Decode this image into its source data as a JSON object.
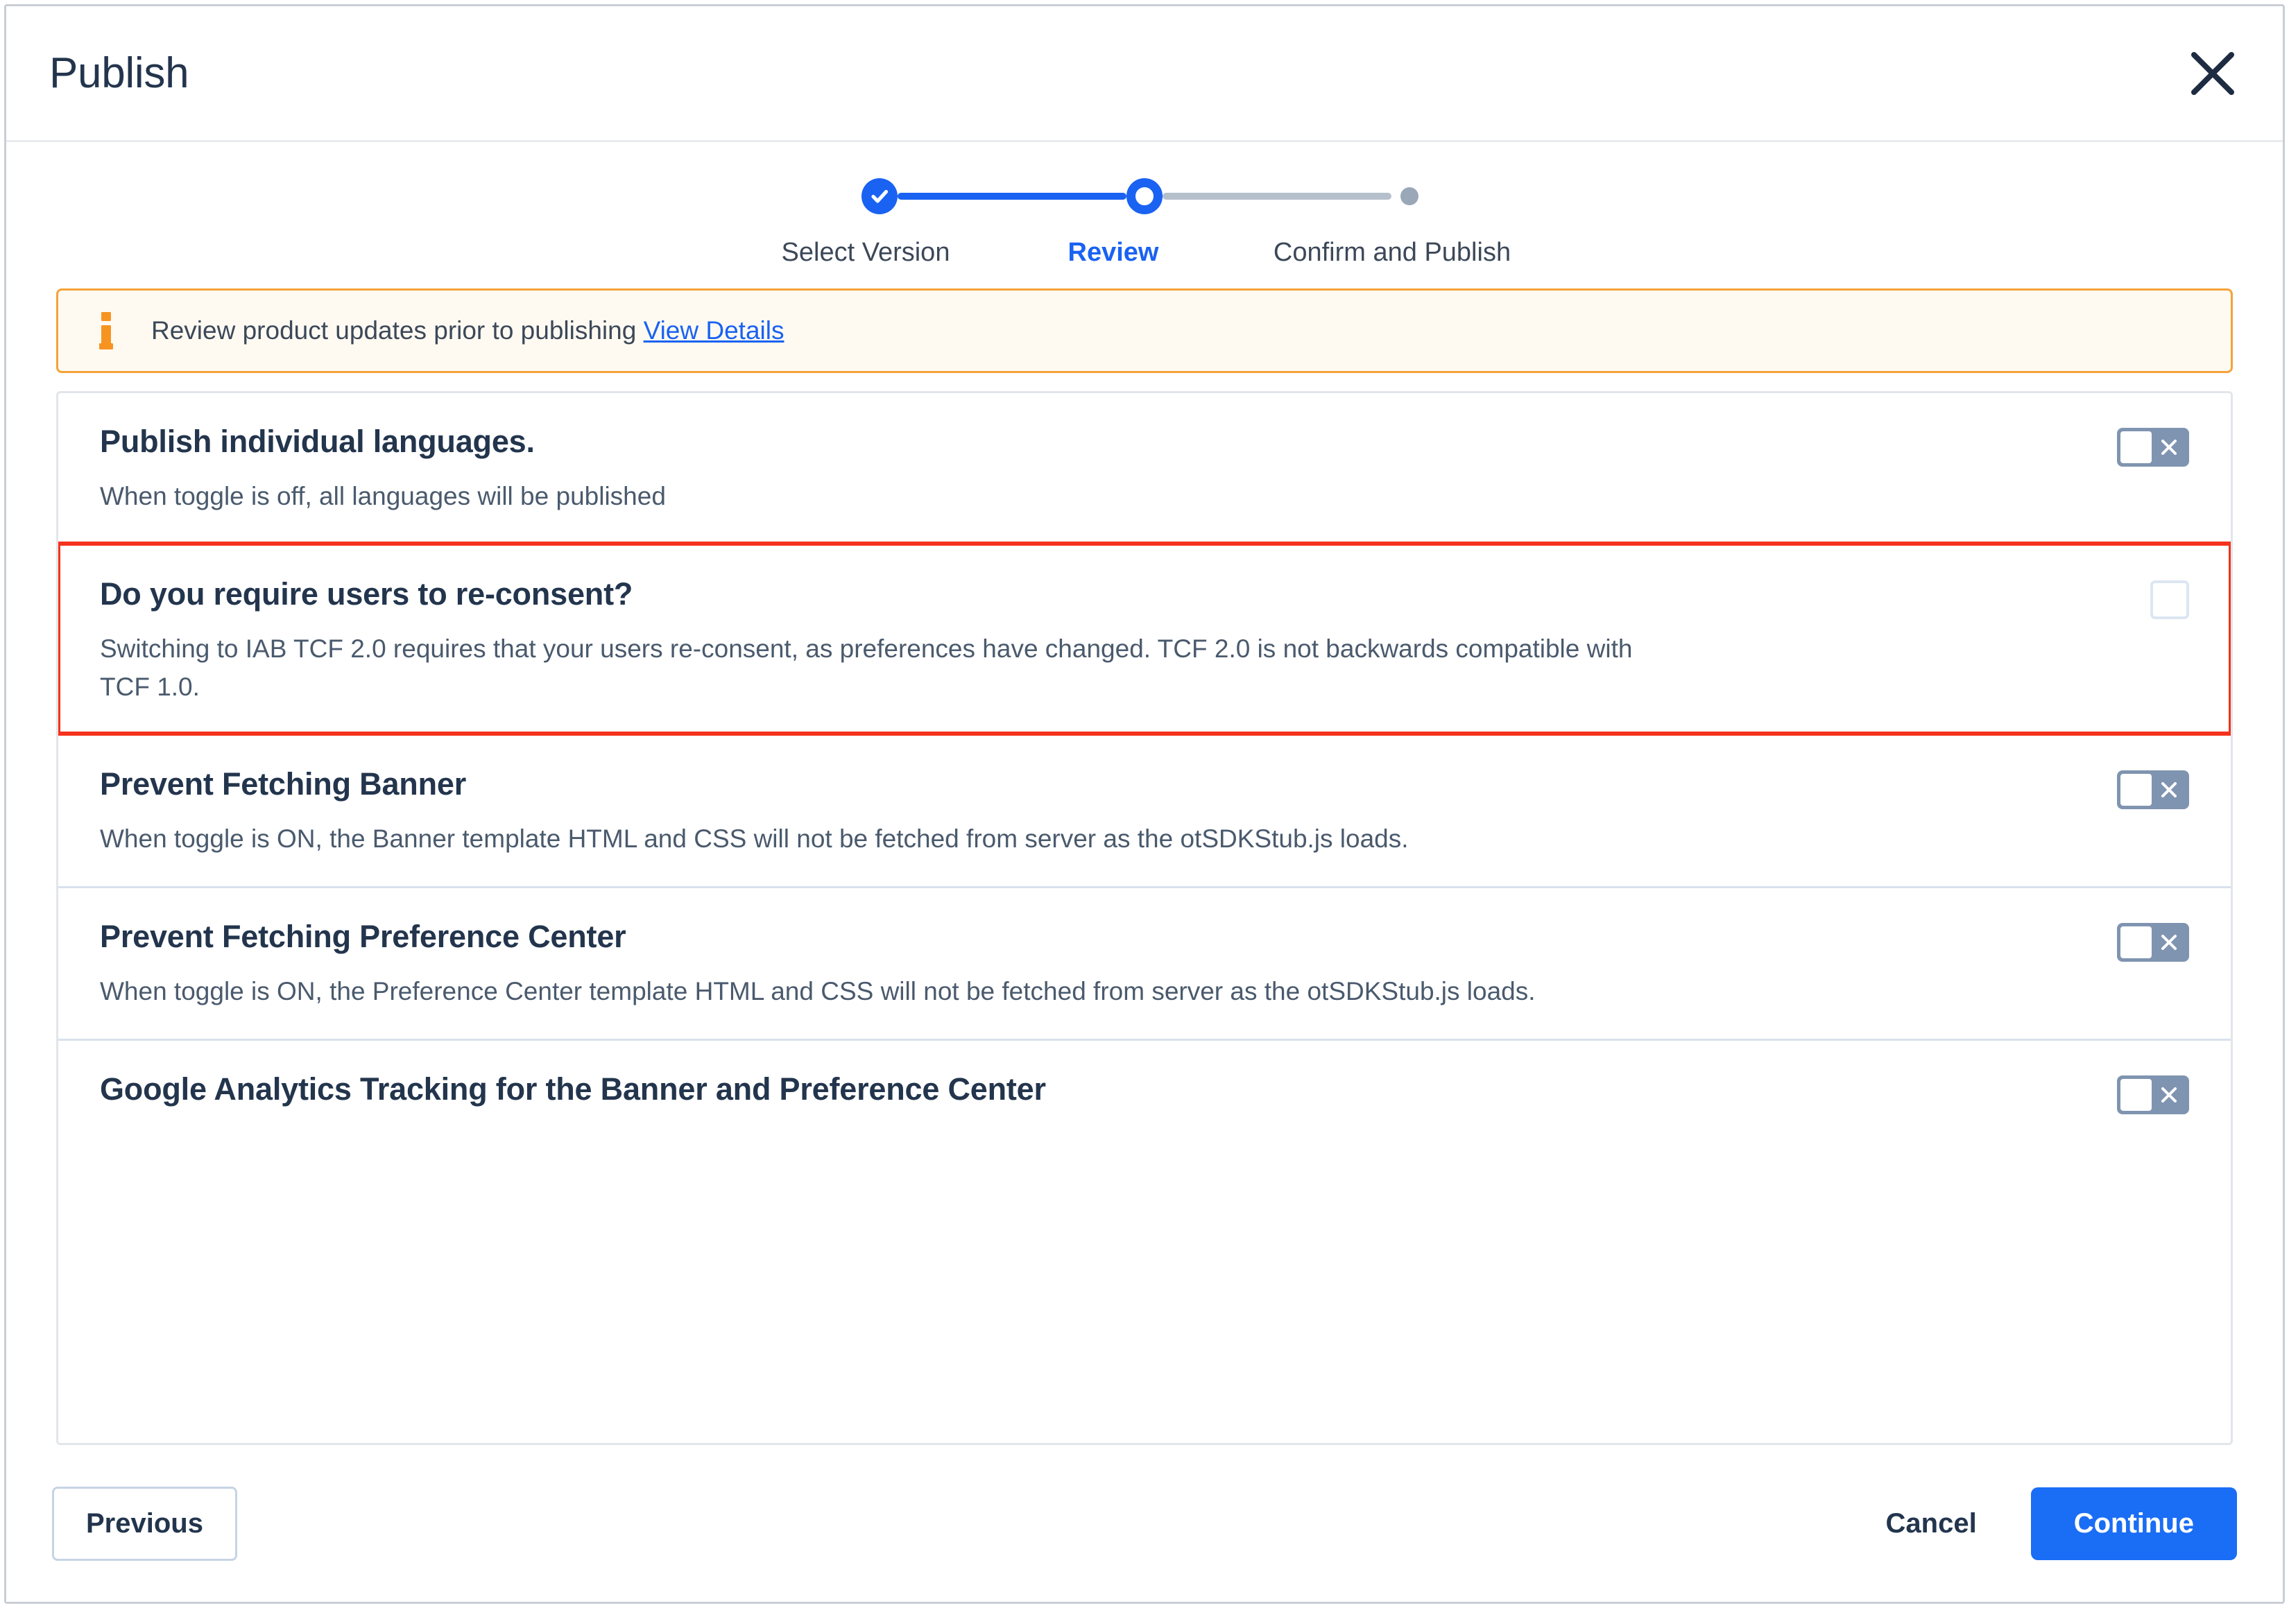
{
  "modal": {
    "title": "Publish",
    "close_icon": "close-icon"
  },
  "stepper": {
    "steps": [
      {
        "label": "Select Version",
        "state": "completed"
      },
      {
        "label": "Review",
        "state": "current"
      },
      {
        "label": "Confirm and Publish",
        "state": "upcoming"
      }
    ],
    "active_color": "#1a62f2",
    "inactive_color": "#b6c0cd"
  },
  "info_banner": {
    "icon": "info-icon",
    "message": "Review product updates prior to publishing",
    "link_label": "View Details",
    "border_color": "#f5a33a",
    "background_color": "#fefaf2"
  },
  "settings": [
    {
      "title": "Publish individual languages.",
      "description": "When toggle is off, all languages will be published",
      "control": "toggle",
      "control_state": "off",
      "highlighted": false
    },
    {
      "title": "Do you require users to re-consent?",
      "description": "Switching to IAB TCF 2.0 requires that your users re-consent, as preferences have changed. TCF 2.0 is not backwards compatible with TCF 1.0.",
      "control": "checkbox",
      "control_state": "unchecked",
      "highlighted": true,
      "highlight_color": "#f5321d"
    },
    {
      "title": "Prevent Fetching Banner",
      "description": "When toggle is ON, the Banner template HTML and CSS will not be fetched from server as the otSDKStub.js loads.",
      "control": "toggle",
      "control_state": "off",
      "highlighted": false
    },
    {
      "title": "Prevent Fetching Preference Center",
      "description": "When toggle is ON, the Preference Center template HTML and CSS will not be fetched from server as the otSDKStub.js loads.",
      "control": "toggle",
      "control_state": "off",
      "highlighted": false
    },
    {
      "title": "Google Analytics Tracking for the Banner and Preference Center",
      "description": "",
      "control": "toggle",
      "control_state": "off",
      "highlighted": false
    }
  ],
  "footer": {
    "previous_label": "Previous",
    "cancel_label": "Cancel",
    "continue_label": "Continue",
    "continue_color": "#1a6df5"
  }
}
